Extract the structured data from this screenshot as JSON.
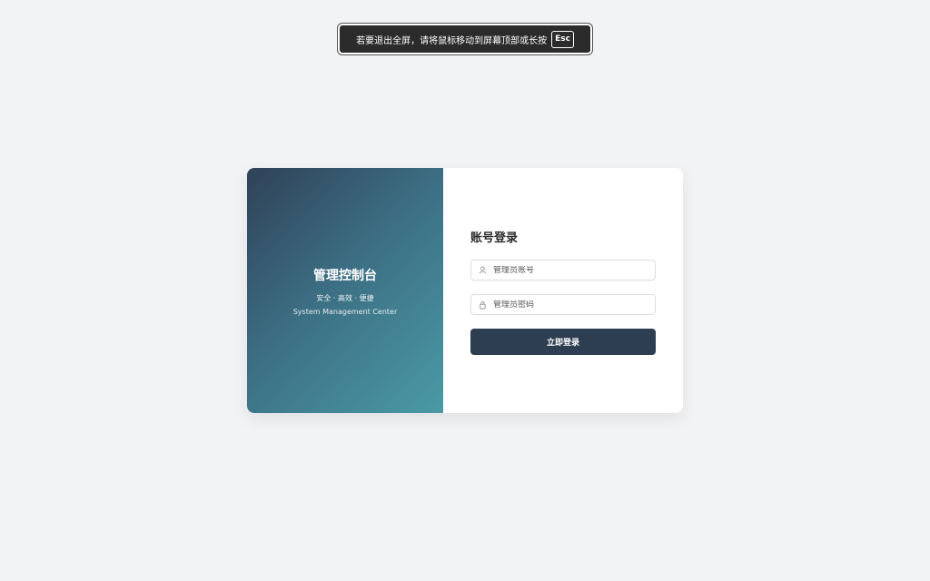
{
  "fullscreen_banner": {
    "message": "若要退出全屏，请将鼠标移动到屏幕顶部或长按",
    "key": "Esc"
  },
  "brand": {
    "title": "管理控制台",
    "subtitle": "安全 · 高效 · 便捷",
    "subtitle_en": "System Management Center"
  },
  "login": {
    "title": "账号登录",
    "username_placeholder": "管理员账号",
    "password_placeholder": "管理员密码",
    "submit_label": "立即登录",
    "user_icon": "user-icon",
    "lock_icon": "lock-icon"
  },
  "colors": {
    "page_bg": "#f2f3f5",
    "button_bg": "#2e3e52",
    "gradient_start": "#2f4157",
    "gradient_end": "#4a9aa6"
  }
}
